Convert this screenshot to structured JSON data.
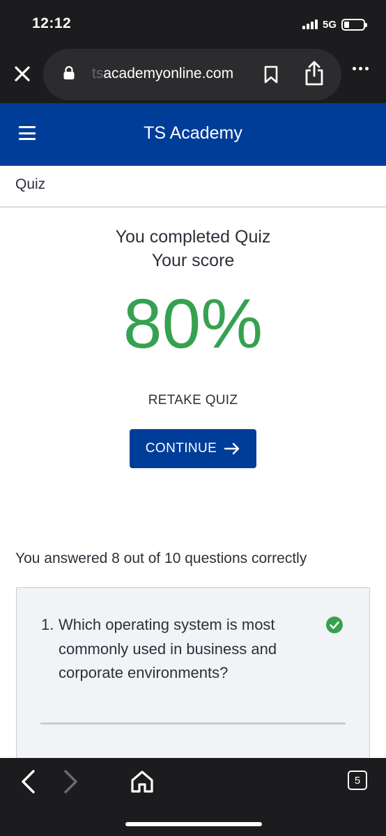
{
  "status_bar": {
    "time": "12:12",
    "network": "5G"
  },
  "browser": {
    "url_faded": "ts",
    "url_main": "academyonline.com",
    "tab_count": "5"
  },
  "site": {
    "title": "TS Academy",
    "brand_color": "#003d99"
  },
  "page": {
    "section_label": "Quiz",
    "completed_line1": "You completed Quiz",
    "completed_line2": "Your score",
    "score": "80%",
    "score_color": "#36a150",
    "retake_label": "RETAKE QUIZ",
    "continue_label": "CONTINUE",
    "continue_icon": "arrow-right-icon",
    "answered_summary": "You answered 8 out of 10 questions correctly"
  },
  "questions": [
    {
      "number": "1.",
      "text": "Which operating system is most commonly used in business and corporate environments?",
      "status_icon": "check-circle-icon"
    }
  ]
}
